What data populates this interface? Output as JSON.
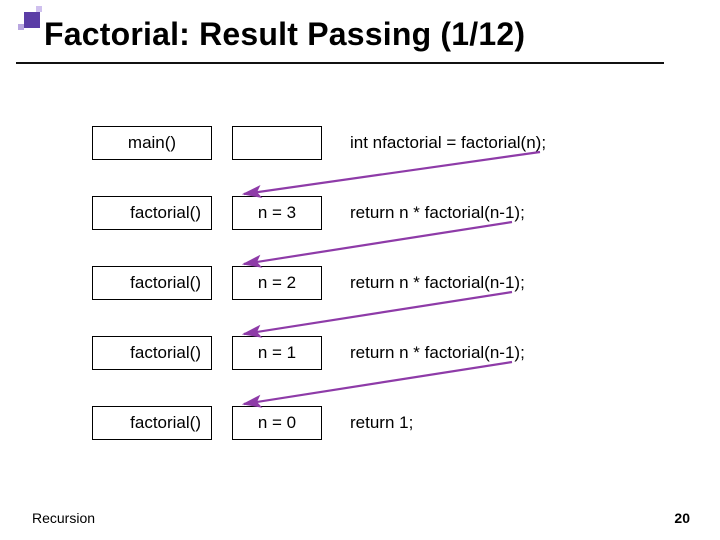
{
  "title": "Factorial: Result Passing (1/12)",
  "rows": [
    {
      "func": "main()",
      "n": "",
      "code": "int nfactorial = factorial(n);"
    },
    {
      "func": "factorial()",
      "n": "n = 3",
      "code": "return n * factorial(n-1);"
    },
    {
      "func": "factorial()",
      "n": "n = 2",
      "code": "return n * factorial(n-1);"
    },
    {
      "func": "factorial()",
      "n": "n = 1",
      "code": "return n * factorial(n-1);"
    },
    {
      "func": "factorial()",
      "n": "n = 0",
      "code": "return 1;"
    }
  ],
  "footer": {
    "left": "Recursion",
    "right": "20"
  },
  "arrow_color": "#8e3ba8"
}
